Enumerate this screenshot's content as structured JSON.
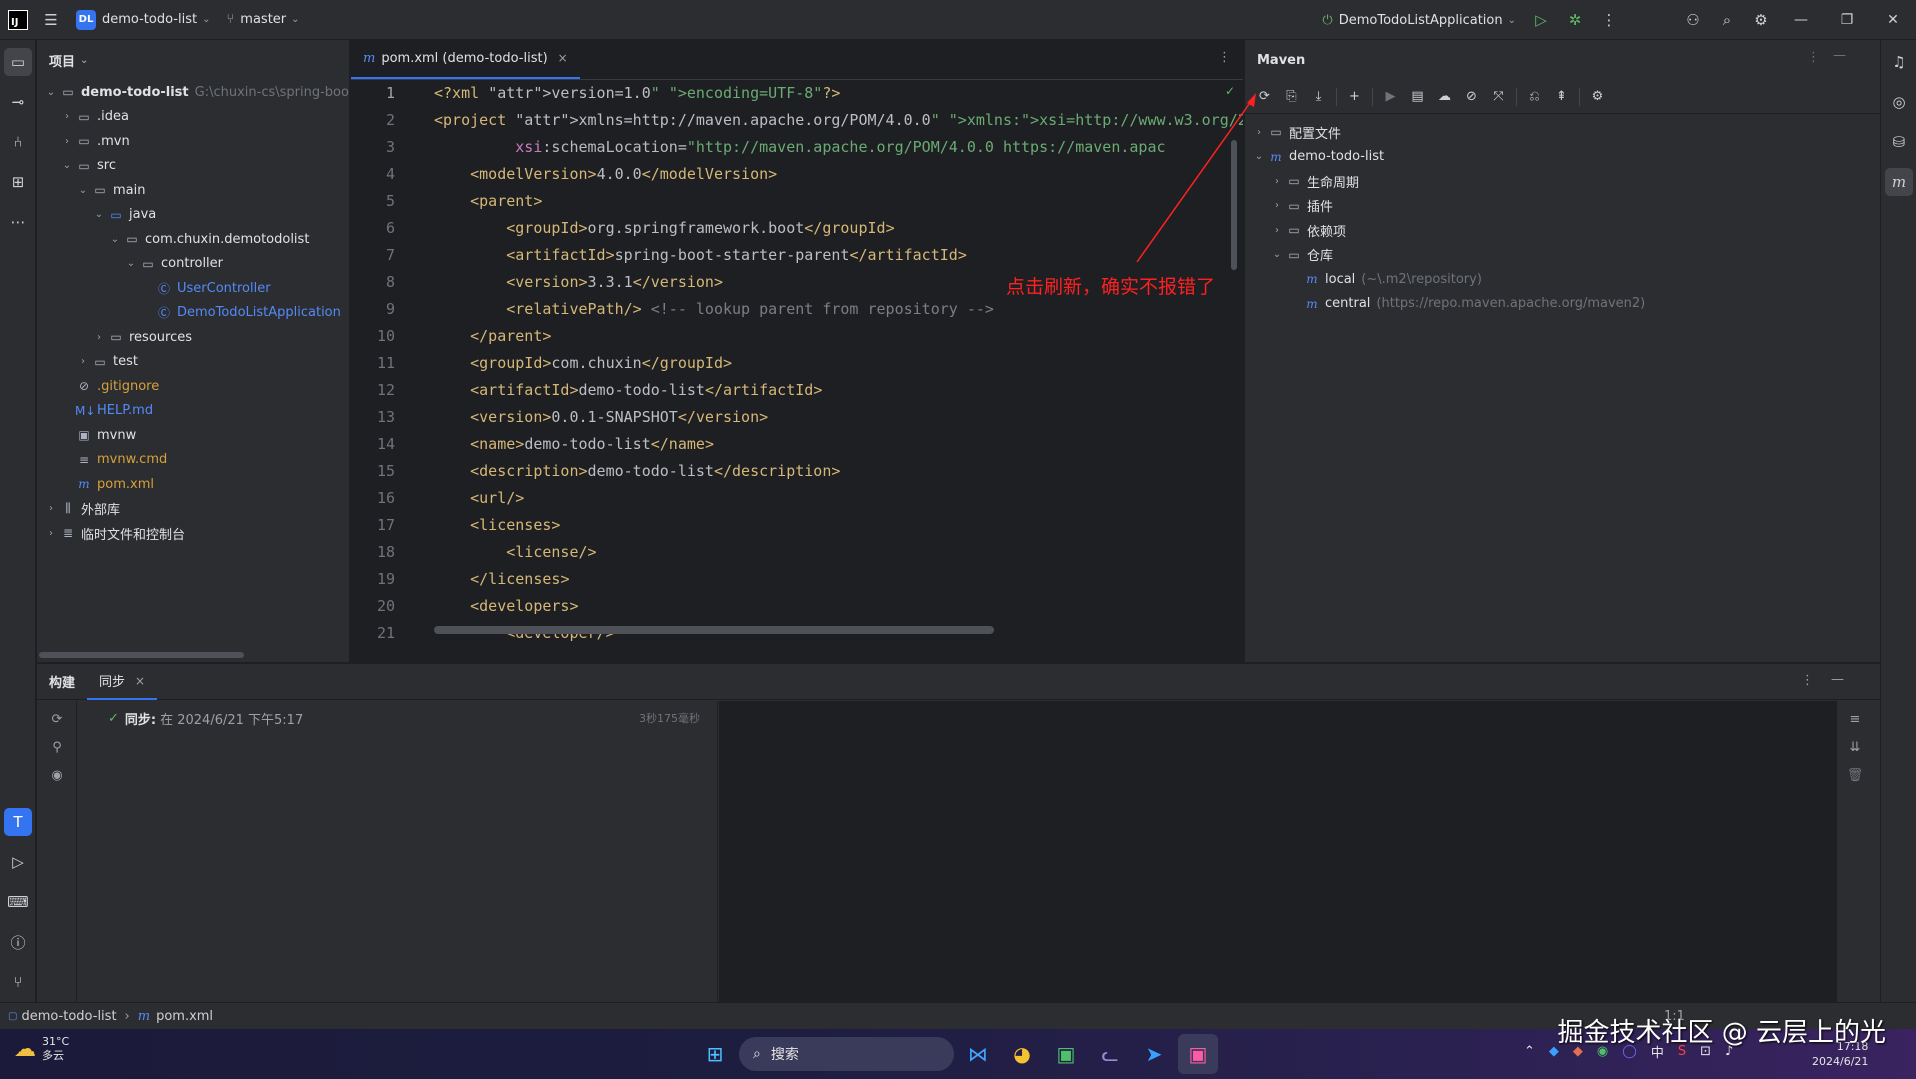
{
  "titlebar": {
    "logo": "IJ",
    "project_badge": "DL",
    "project_name": "demo-todo-list",
    "branch": "master",
    "run_config": "DemoTodoListApplication"
  },
  "project_panel": {
    "title": "项目",
    "tree": [
      {
        "label": "demo-todo-list",
        "path": "G:\\chuxin-cs\\spring-boo",
        "depth": 0,
        "open": true,
        "icon": "module-folder"
      },
      {
        "label": ".idea",
        "depth": 1,
        "open": false,
        "icon": "folder"
      },
      {
        "label": ".mvn",
        "depth": 1,
        "open": false,
        "icon": "folder"
      },
      {
        "label": "src",
        "depth": 1,
        "open": true,
        "icon": "folder"
      },
      {
        "label": "main",
        "depth": 2,
        "open": true,
        "icon": "folder"
      },
      {
        "label": "java",
        "depth": 3,
        "open": true,
        "icon": "source-folder"
      },
      {
        "label": "com.chuxin.demotodolist",
        "depth": 4,
        "open": true,
        "icon": "package"
      },
      {
        "label": "controller",
        "depth": 5,
        "open": true,
        "icon": "package"
      },
      {
        "label": "UserController",
        "depth": 6,
        "icon": "class",
        "color": "blue"
      },
      {
        "label": "DemoTodoListApplication",
        "depth": 6,
        "icon": "spring-class",
        "color": "blue"
      },
      {
        "label": "resources",
        "depth": 3,
        "open": false,
        "icon": "resources-folder"
      },
      {
        "label": "test",
        "depth": 2,
        "open": false,
        "icon": "folder"
      },
      {
        "label": ".gitignore",
        "depth": 1,
        "icon": "ignore-file",
        "color": "orange"
      },
      {
        "label": "HELP.md",
        "depth": 1,
        "icon": "markdown-file",
        "color": "blue"
      },
      {
        "label": "mvnw",
        "depth": 1,
        "icon": "terminal-file"
      },
      {
        "label": "mvnw.cmd",
        "depth": 1,
        "icon": "text-file",
        "color": "orange"
      },
      {
        "label": "pom.xml",
        "depth": 1,
        "icon": "maven-file",
        "color": "orange"
      },
      {
        "label": "外部库",
        "depth": 0,
        "open": false,
        "icon": "library"
      },
      {
        "label": "临时文件和控制台",
        "depth": 0,
        "open": false,
        "icon": "scratches"
      }
    ]
  },
  "editor": {
    "tab_label": "pom.xml (demo-todo-list)",
    "lines": [
      "<?xml version=\"1.0\" encoding=\"UTF-8\"?>",
      "<project xmlns=\"http://maven.apache.org/POM/4.0.0\" xmlns:xsi=\"http://www.w3.org/2",
      "         xsi:schemaLocation=\"http://maven.apache.org/POM/4.0.0 https://maven.apac",
      "    <modelVersion>4.0.0</modelVersion>",
      "    <parent>",
      "        <groupId>org.springframework.boot</groupId>",
      "        <artifactId>spring-boot-starter-parent</artifactId>",
      "        <version>3.3.1</version>",
      "        <relativePath/> <!-- lookup parent from repository -->",
      "    </parent>",
      "    <groupId>com.chuxin</groupId>",
      "    <artifactId>demo-todo-list</artifactId>",
      "    <version>0.0.1-SNAPSHOT</version>",
      "    <name>demo-todo-list</name>",
      "    <description>demo-todo-list</description>",
      "    <url/>",
      "    <licenses>",
      "        <license/>",
      "    </licenses>",
      "    <developers>",
      "        <developer/>"
    ],
    "line_numbers": [
      "1",
      "2",
      "3",
      "4",
      "5",
      "6",
      "7",
      "8",
      "9",
      "10",
      "11",
      "12",
      "13",
      "14",
      "15",
      "16",
      "17",
      "18",
      "19",
      "20",
      "21"
    ]
  },
  "maven": {
    "title": "Maven",
    "tree": [
      {
        "label": "配置文件",
        "depth": 0,
        "open": false,
        "icon": "folder"
      },
      {
        "label": "demo-todo-list",
        "depth": 0,
        "open": true,
        "icon": "maven"
      },
      {
        "label": "生命周期",
        "depth": 1,
        "open": false,
        "icon": "folder"
      },
      {
        "label": "插件",
        "depth": 1,
        "open": false,
        "icon": "folder"
      },
      {
        "label": "依赖项",
        "depth": 1,
        "open": false,
        "icon": "folder"
      },
      {
        "label": "仓库",
        "depth": 1,
        "open": true,
        "icon": "folder"
      },
      {
        "label": "local",
        "detail": "(~\\.m2\\repository)",
        "depth": 2,
        "icon": "maven"
      },
      {
        "label": "central",
        "detail": "(https://repo.maven.apache.org/maven2)",
        "depth": 2,
        "icon": "maven-remote"
      }
    ]
  },
  "annotation": "点击刷新，确实不报错了",
  "bottom_panel": {
    "tab_build": "构建",
    "tab_sync": "同步",
    "sync_label": "同步:",
    "sync_text": "在 2024/6/21 下午5:17",
    "sync_duration": "3秒175毫秒"
  },
  "statusbar": {
    "crumb_project": "demo-todo-list",
    "crumb_file": "pom.xml",
    "position": "1:1"
  },
  "taskbar": {
    "temp": "31°C",
    "weather": "多云",
    "search_placeholder": "搜索",
    "ime": "中",
    "time": "17:18",
    "date": "2024/6/21"
  },
  "watermark": "掘金技术社区 @ 云层上的光"
}
